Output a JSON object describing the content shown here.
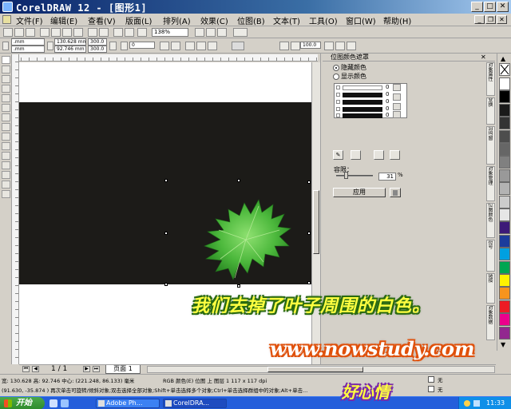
{
  "window": {
    "title": "CorelDRAW 12 - [图形1]",
    "min_glyph": "_",
    "max_glyph": "□",
    "close_glyph": "✕",
    "mdi_min_glyph": "_",
    "mdi_restore_glyph": "❐",
    "mdi_close_glyph": "✕"
  },
  "menu": [
    "文件(F)",
    "编辑(E)",
    "查看(V)",
    "版面(L)",
    "排列(A)",
    "效果(C)",
    "位图(B)",
    "文本(T)",
    "工具(O)",
    "窗口(W)",
    "帮助(H)"
  ],
  "property_bar": {
    "x": ".mm",
    "y": ".mm",
    "width": "130.628 mm",
    "height": "92.746 mm",
    "scale_x": "300.0",
    "scale_y": "300.0",
    "rotation": "0",
    "outline_width": "100.0"
  },
  "zoom": "138%",
  "docker": {
    "title": "位图颜色遮罩",
    "option_hide": "隐藏颜色",
    "option_show": "显示颜色",
    "color_rows": [
      {
        "value": "0"
      },
      {
        "value": "0"
      },
      {
        "value": "0"
      },
      {
        "value": "0"
      },
      {
        "value": "0"
      }
    ],
    "tolerance_label": "容限：",
    "tolerance_value": "31",
    "tolerance_unit": "%",
    "apply_label": "应用"
  },
  "docker_tabs": [
    "对象属性",
    "变换",
    "泊坞窗",
    "对象管理",
    "位图颜色",
    "符号",
    "链接",
    "对象数据"
  ],
  "palette": {
    "colors": [
      "#ffffff",
      "#000000",
      "#1a1a1a",
      "#333333",
      "#4d4d4d",
      "#666666",
      "#808080",
      "#999999",
      "#b3b3b3",
      "#cccccc",
      "#e6e6e6",
      "#3d1a78",
      "#1c3c9c",
      "#00a0e0",
      "#00a651",
      "#fff200",
      "#f7941d",
      "#ed1c24",
      "#ec008c",
      "#92278f"
    ]
  },
  "pages": {
    "current": "1 / 1",
    "tab_label": "页面 1"
  },
  "status": {
    "line1": "宽: 130.628 高: 92.746 中心: (221.248, 86.133) 毫米",
    "line1_right": "RGB 颜色(E) 位图 上 图层 1 117 x 117 dpi",
    "line2": "(91.630, -35.874 ) 再次单击可旋转/倾斜对象;双击选择全部对象;Shift+单击选择多个对象;Ctrl+单击选择群组中的对象;Alt+单击...",
    "fill": "无",
    "outline": "无"
  },
  "taskbar": {
    "start": "开始",
    "tasks": [
      "Adobe Ph...",
      "CorelDRA..."
    ],
    "clock": "11:33"
  },
  "captions": {
    "line1": "我们去掉了叶子周围的白色。",
    "line2": "www.nowstudy.com",
    "line3": "好心情"
  }
}
